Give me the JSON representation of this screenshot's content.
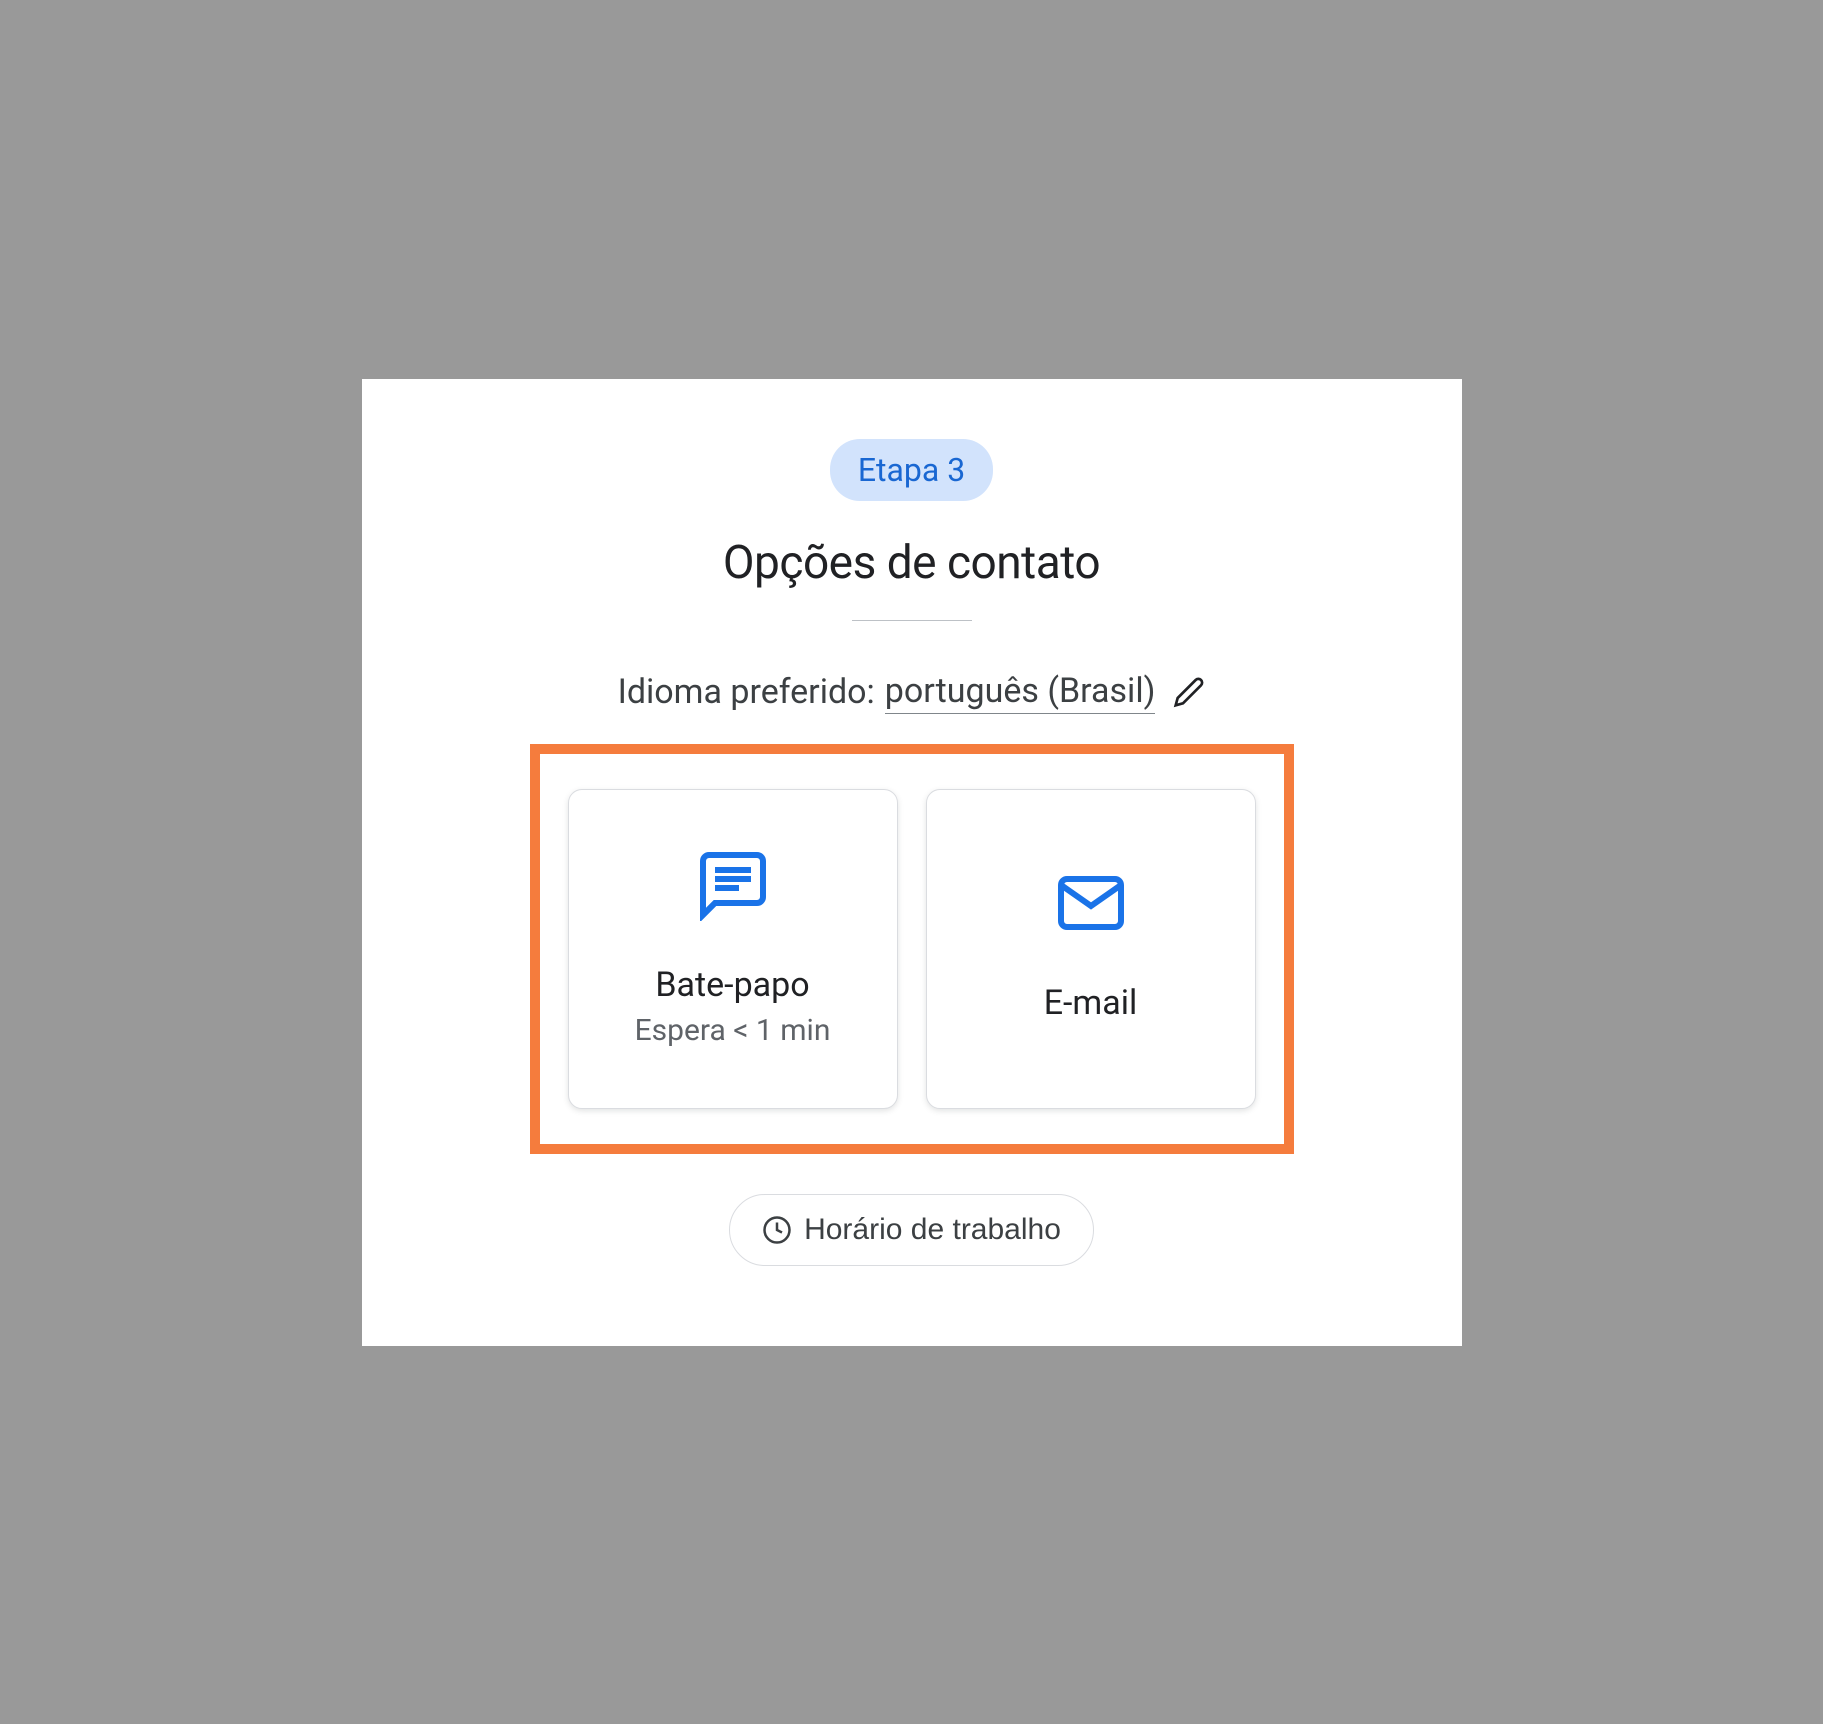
{
  "step": {
    "label": "Etapa 3"
  },
  "title": "Opções de contato",
  "language": {
    "label": "Idioma preferido:",
    "value": "português (Brasil)"
  },
  "options": {
    "chat": {
      "title": "Bate-papo",
      "subtitle": "Espera < 1 min"
    },
    "email": {
      "title": "E-mail"
    }
  },
  "hours_button": "Horário de trabalho",
  "colors": {
    "accent_blue": "#1a73e8",
    "highlight_orange": "#f57c3d",
    "badge_bg": "#d2e3fc",
    "badge_text": "#1967d2"
  }
}
